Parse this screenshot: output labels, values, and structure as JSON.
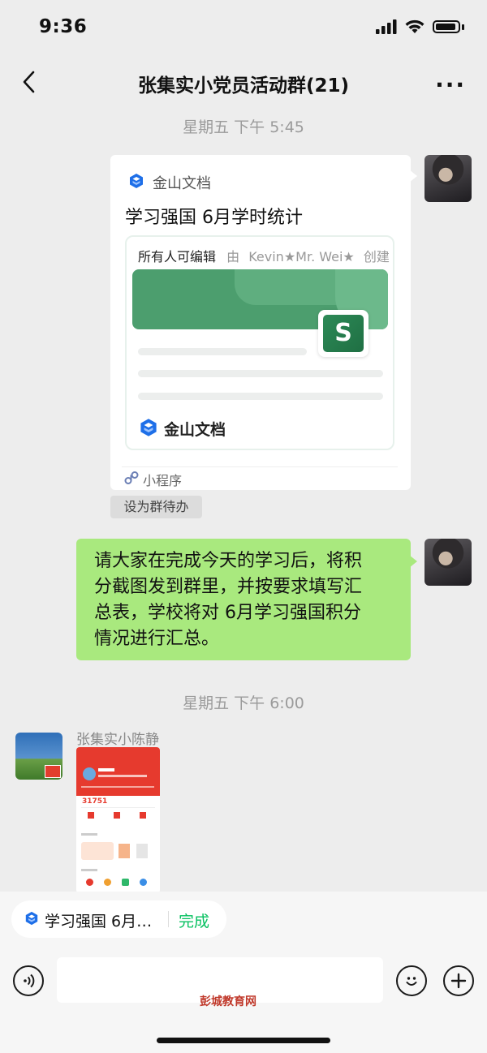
{
  "status_bar": {
    "time": "9:36"
  },
  "header": {
    "title": "张集实小党员活动群(21)",
    "more": "···"
  },
  "timestamps": [
    "星期五 下午 5:45",
    "星期五 下午 6:00"
  ],
  "doc_card": {
    "app_name": "金山文档",
    "title": "学习强国 6月学时统计",
    "editable": "所有人可编辑",
    "by": "由",
    "creator": "Kevin★Mr. Wei★",
    "created": "创建",
    "brand": "金山文档",
    "sheet_letter": "S",
    "mini_program": "小程序"
  },
  "todo_button": "设为群待办",
  "message": {
    "lines": [
      "请大家在完成今天的学习后，将积",
      "分截图发到群里，并按要求填写汇",
      "总表，学校将对 6月学习强国积分",
      "情况进行汇总。"
    ]
  },
  "sender": {
    "name": "张集实小陈静"
  },
  "thumbnail": {
    "score": "31751"
  },
  "quote_bar": {
    "doc_title": "学习强国 6月…",
    "done": "完成"
  },
  "watermark": "彭城教育网",
  "colors": {
    "bubble": "#a9e97e",
    "done": "#07c160",
    "brand_blue": "#1e6fe8"
  }
}
